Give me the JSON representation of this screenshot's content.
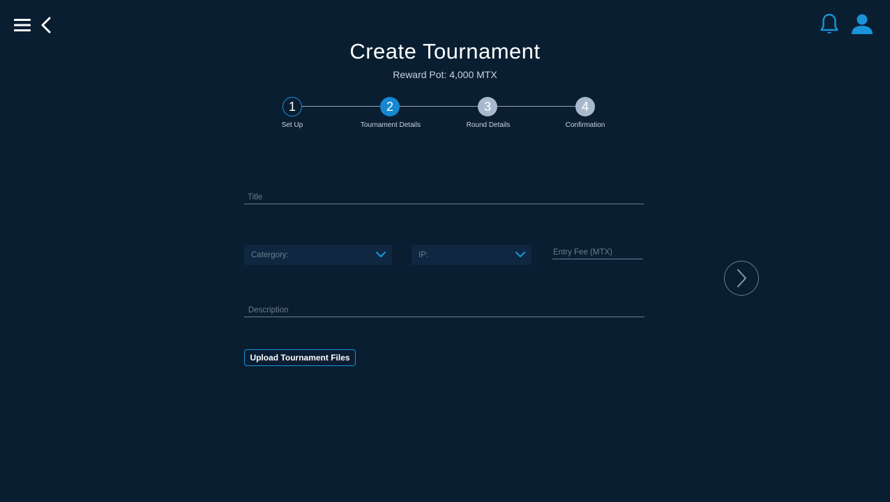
{
  "header": {
    "title": "Create Tournament",
    "reward_pot": "Reward Pot: 4,000 MTX"
  },
  "nav": {
    "menu_icon": "hamburger-menu-icon",
    "back_icon": "chevron-left-icon",
    "notifications_icon": "bell-icon",
    "profile_icon": "user-icon"
  },
  "stepper": {
    "steps": [
      {
        "number": "1",
        "label": "Set Up",
        "state": "completed"
      },
      {
        "number": "2",
        "label": "Tournament Details",
        "state": "active"
      },
      {
        "number": "3",
        "label": "Round Details",
        "state": "upcoming"
      },
      {
        "number": "4",
        "label": "Confirmation",
        "state": "upcoming"
      }
    ]
  },
  "form": {
    "title_placeholder": "Title",
    "category_label": "Catergory:",
    "ip_label": "IP:",
    "entry_fee_placeholder": "Entry Fee (MTX)",
    "description_placeholder": "Description",
    "upload_button": "Upload Tournament Files"
  },
  "colors": {
    "background": "#0a1e32",
    "accent": "#1688cf",
    "step_upcoming": "#a9b9cd"
  }
}
